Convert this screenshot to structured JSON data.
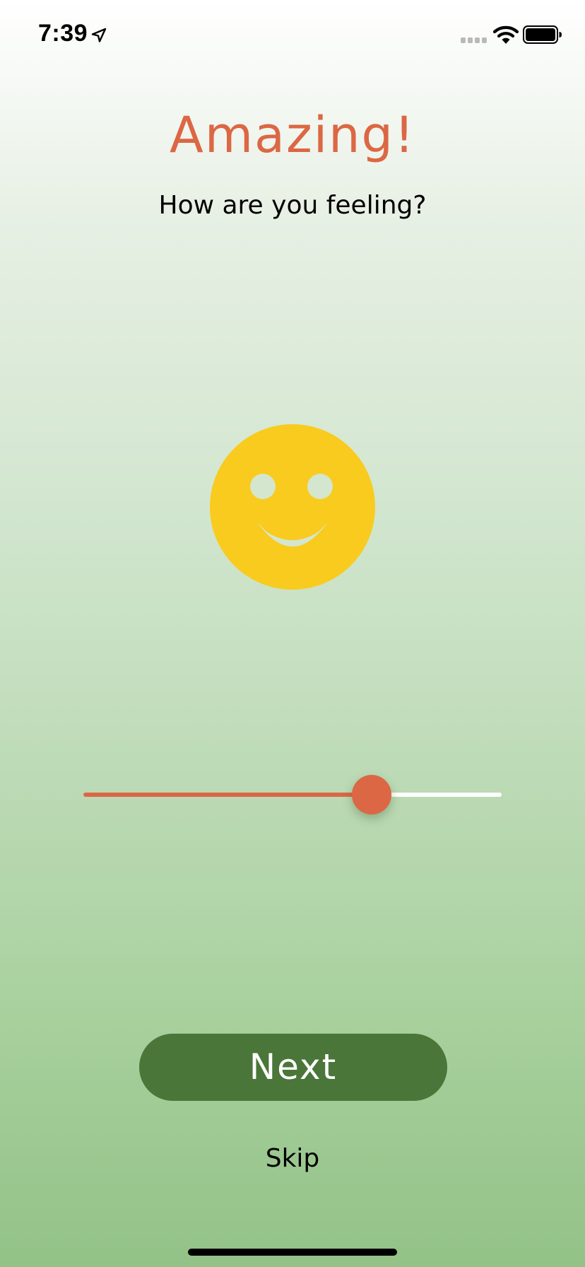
{
  "status_bar": {
    "time": "7:39",
    "icons": [
      "location-arrow-icon",
      "cellular-signal-icon",
      "wifi-icon",
      "battery-icon"
    ]
  },
  "screen": {
    "title": "Amazing!",
    "question": "How are you feeling?"
  },
  "mood": {
    "face": "smiling-face-icon",
    "slider_value": 0.69
  },
  "actions": {
    "next_label": "Next",
    "skip_label": "Skip"
  },
  "colors": {
    "accent": "#dc6744",
    "face": "#f9cb1f",
    "button": "#4a7639",
    "track": "#ffffff"
  }
}
